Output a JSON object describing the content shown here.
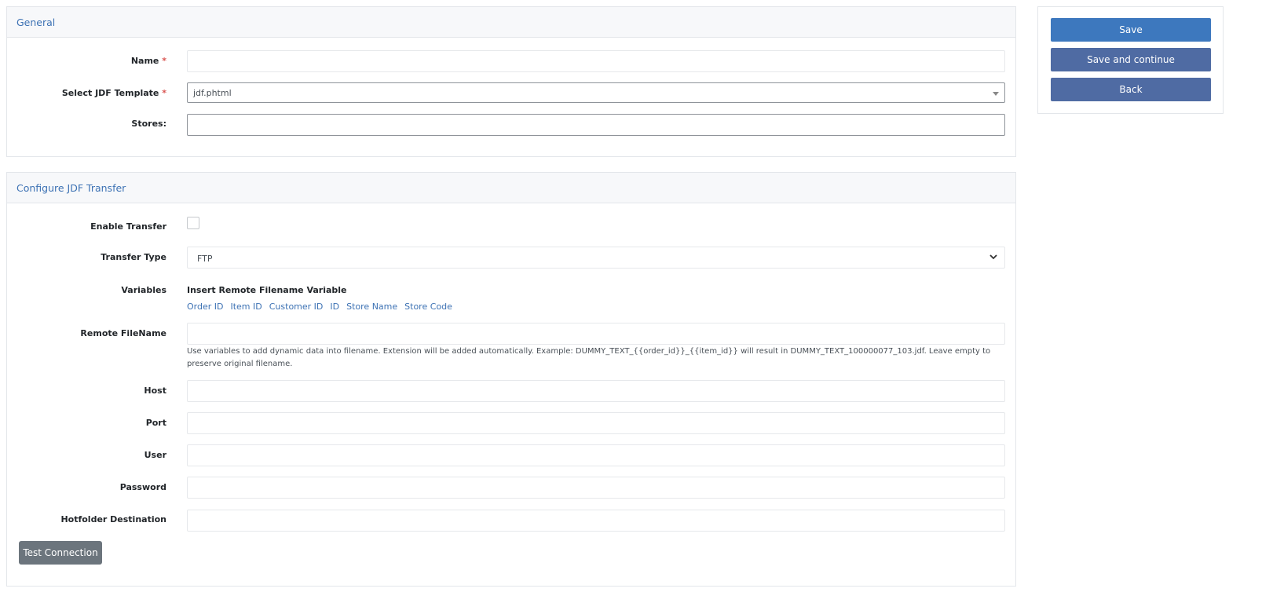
{
  "general": {
    "title": "General",
    "name_label": "Name",
    "required_mark": "*",
    "template_label": "Select JDF Template",
    "template_value": "jdf.phtml",
    "stores_label": "Stores:"
  },
  "transfer": {
    "title": "Configure JDF Transfer",
    "enable_label": "Enable Transfer",
    "type_label": "Transfer Type",
    "type_value": "FTP",
    "variables_label": "Variables",
    "variables_title": "Insert Remote Filename Variable",
    "variable_links": [
      "Order ID",
      "Item ID",
      "Customer ID",
      "ID",
      "Store Name",
      "Store Code"
    ],
    "remote_filename_label": "Remote FileName",
    "remote_filename_help": "Use variables to add dynamic data into filename. Extension will be added automatically. Example: DUMMY_TEXT_{{order_id}}_{{item_id}} will result in DUMMY_TEXT_100000077_103.jdf. Leave empty to preserve original filename.",
    "host_label": "Host",
    "port_label": "Port",
    "user_label": "User",
    "password_label": "Password",
    "hotfolder_label": "Hotfolder Destination",
    "test_button": "Test Connection"
  },
  "actions": {
    "save": "Save",
    "save_continue": "Save and continue",
    "back": "Back"
  }
}
